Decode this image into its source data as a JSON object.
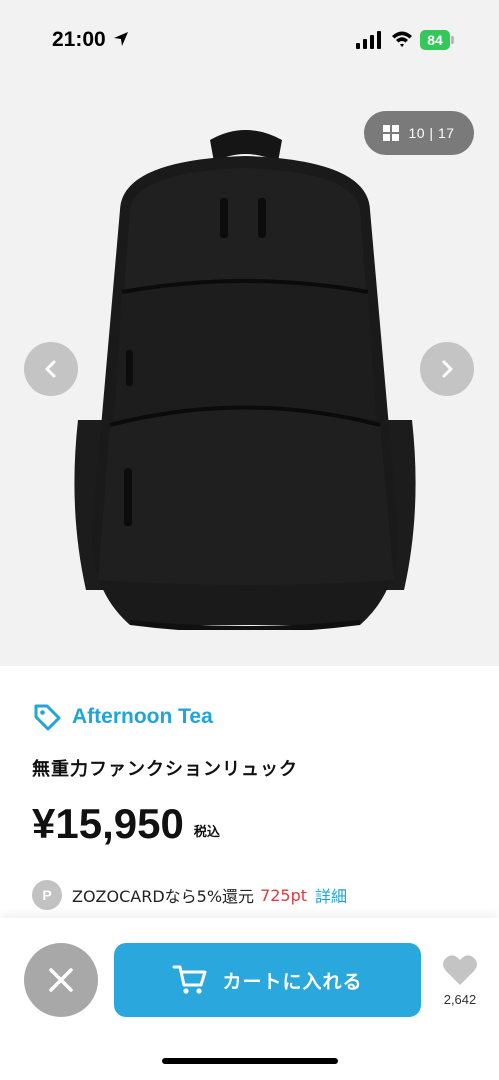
{
  "status_bar": {
    "time": "21:00",
    "battery": "84",
    "icons": [
      "location-arrow-icon",
      "cellular-signal-icon",
      "wifi-icon",
      "battery-icon"
    ]
  },
  "gallery": {
    "counter": "10 | 17",
    "icons": [
      "grid-icon",
      "chevron-left-icon",
      "chevron-right-icon"
    ]
  },
  "product": {
    "brand": "Afternoon Tea",
    "brand_icon": "tag-icon",
    "name": "無重力ファンクションリュック",
    "price": "¥15,950",
    "tax_note": "税込"
  },
  "points": {
    "badge": "P",
    "text": "ZOZOCARDなら5%還元",
    "value": "725pt",
    "link": "詳細"
  },
  "actions": {
    "cart_label": "カートに入れる",
    "favorite_count": "2,642",
    "icons": [
      "close-icon",
      "cart-icon",
      "heart-icon"
    ]
  },
  "colors": {
    "accent": "#2aa7dc",
    "brand_text": "#1fa5d8",
    "points_value": "#e0383e",
    "battery": "#34c759"
  }
}
